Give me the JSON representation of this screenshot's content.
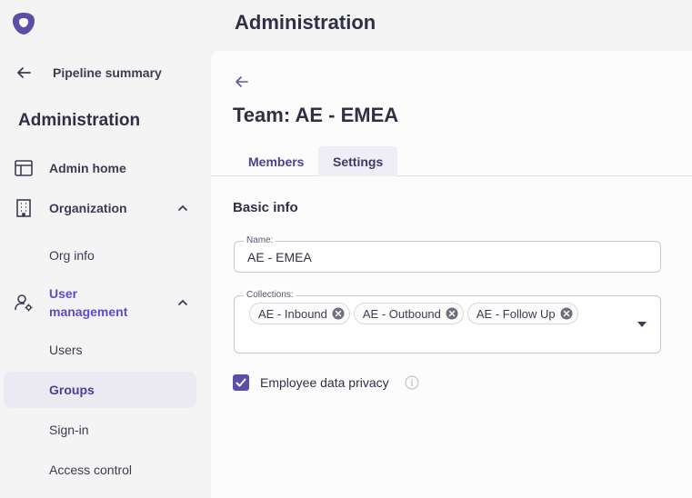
{
  "sidebar": {
    "back_label": "Pipeline summary",
    "title": "Administration",
    "items": [
      {
        "label": "Admin home",
        "icon": "table-icon"
      },
      {
        "label": "Organization",
        "icon": "building-icon"
      },
      {
        "label": "Org info"
      },
      {
        "label": "User management",
        "icon": "user-gear-icon"
      },
      {
        "label": "Users"
      },
      {
        "label": "Groups",
        "active": true
      },
      {
        "label": "Sign-in"
      },
      {
        "label": "Access control"
      }
    ]
  },
  "header": {
    "title": "Administration"
  },
  "main": {
    "team_title": "Team: AE - EMEA",
    "tabs": [
      {
        "label": "Members"
      },
      {
        "label": "Settings",
        "selected": true
      }
    ],
    "section_title": "Basic info",
    "name_field": {
      "label": "Name:",
      "value": "AE - EMEA"
    },
    "collections_field": {
      "label": "Collections:",
      "chips": [
        "AE - Inbound",
        "AE - Outbound",
        "AE - Follow Up"
      ]
    },
    "privacy_checkbox": {
      "label": "Employee data privacy",
      "checked": true
    }
  },
  "colors": {
    "accent": "#5b4fa5",
    "sidebar_bg": "#f5f4f5",
    "panel_bg": "#fdfcfc"
  }
}
